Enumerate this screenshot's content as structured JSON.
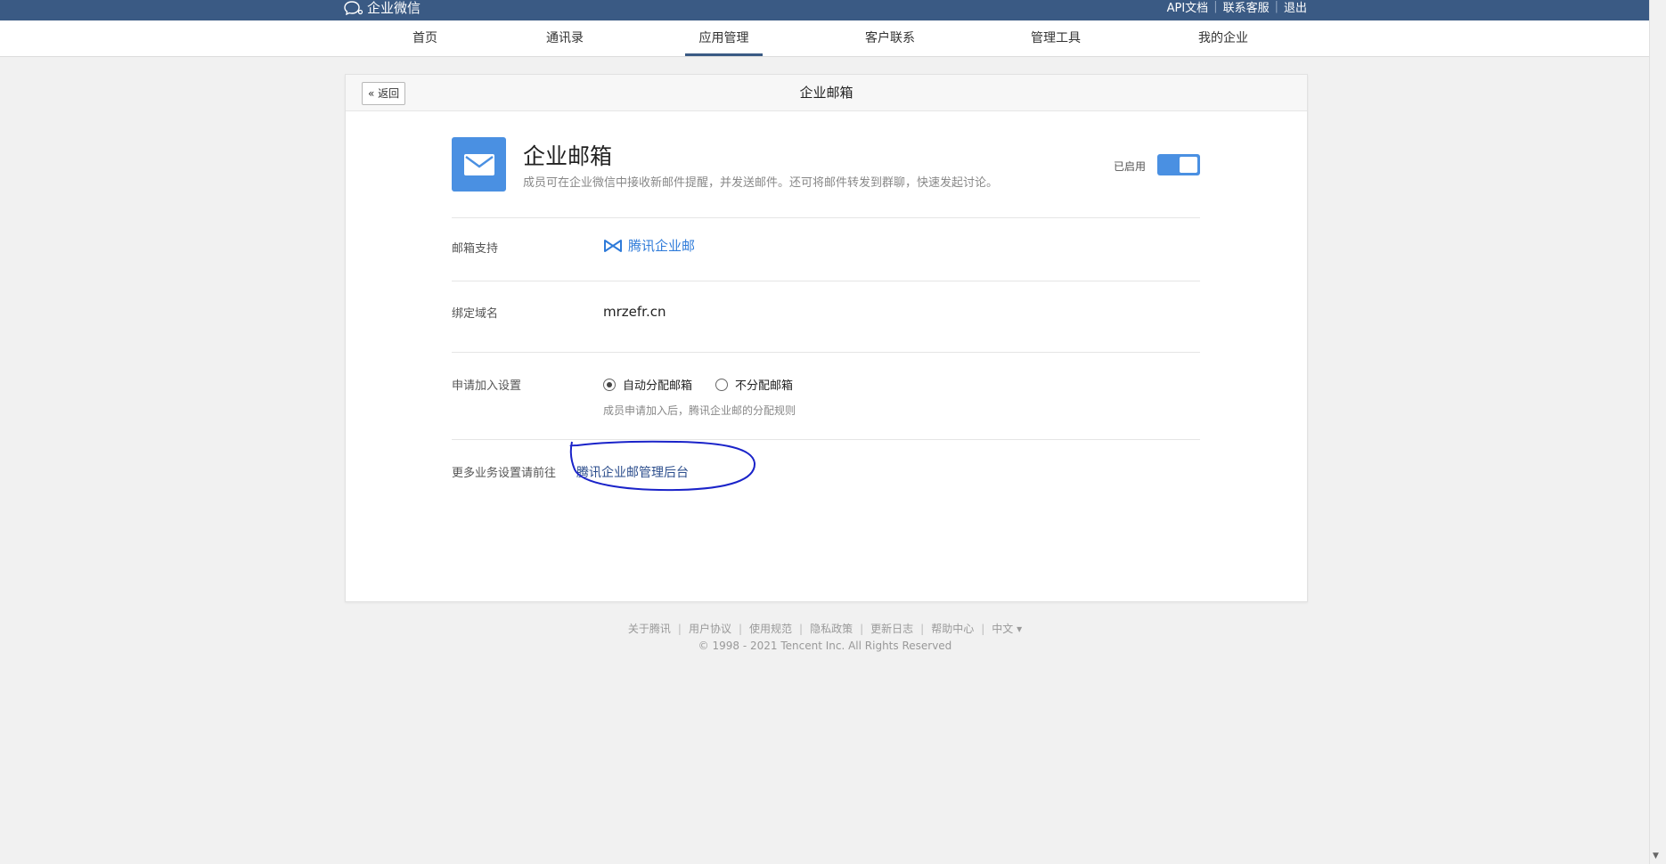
{
  "topbar": {
    "brand": "企业微信",
    "links": [
      "API文档",
      "联系客服",
      "退出"
    ]
  },
  "nav": {
    "items": [
      {
        "label": "首页"
      },
      {
        "label": "通讯录"
      },
      {
        "label": "应用管理",
        "active": true
      },
      {
        "label": "客户联系"
      },
      {
        "label": "管理工具"
      },
      {
        "label": "我的企业"
      }
    ]
  },
  "page": {
    "back_label": "返回",
    "title": "企业邮箱"
  },
  "app": {
    "name": "企业邮箱",
    "description": "成员可在企业微信中接收新邮件提醒，并发送邮件。还可将邮件转发到群聊，快速发起讨论。",
    "status_label": "已启用",
    "enabled": true,
    "icon": "mail-icon",
    "icon_color": "#4a90e2"
  },
  "settings": {
    "mail_support_label": "邮箱支持",
    "mail_provider": "腾讯企业邮",
    "domain_label": "绑定域名",
    "domain_value": "mrzefr.cn",
    "join_label": "申请加入设置",
    "join_options": [
      {
        "label": "自动分配邮箱",
        "checked": true
      },
      {
        "label": "不分配邮箱",
        "checked": false
      }
    ],
    "join_hint": "成员申请加入后，腾讯企业邮的分配规则",
    "more_label": "更多业务设置请前往",
    "more_link": "腾讯企业邮管理后台"
  },
  "footer": {
    "links": [
      "关于腾讯",
      "用户协议",
      "使用规范",
      "隐私政策",
      "更新日志",
      "帮助中心",
      "中文 ▾"
    ],
    "copyright": "© 1998 - 2021 Tencent Inc. All Rights Reserved"
  },
  "colors": {
    "topbar": "#3a5a84",
    "accent": "#4a90e2",
    "link": "#2f7bd9",
    "annotation": "#1a23c9"
  }
}
